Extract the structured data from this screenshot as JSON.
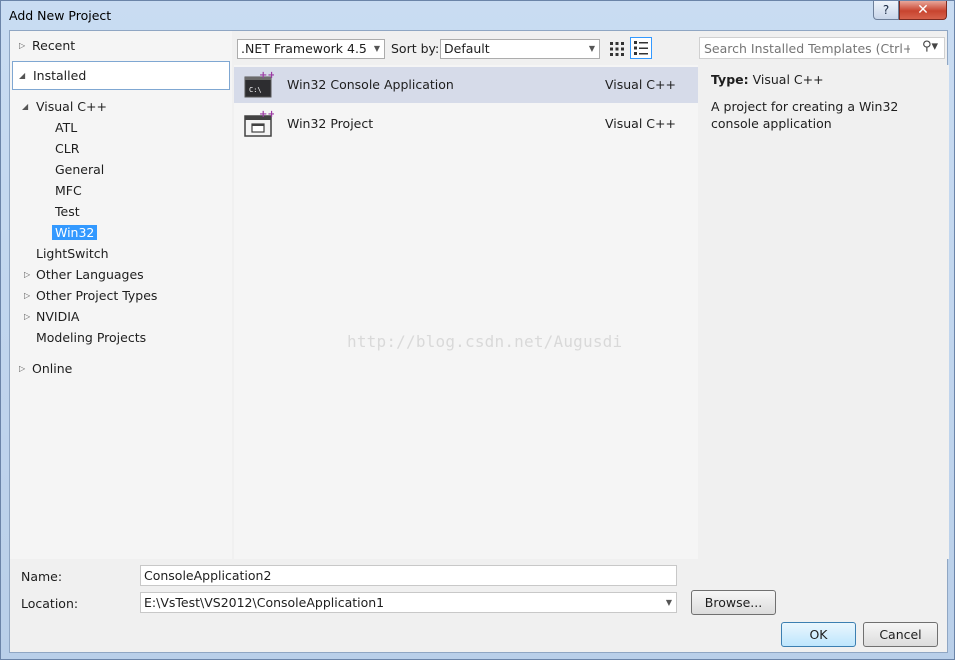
{
  "window": {
    "title": "Add New Project",
    "help_glyph": "?",
    "close_glyph": "✕"
  },
  "left_tree": {
    "recent": "Recent",
    "installed": "Installed",
    "visual_cpp": "Visual C++",
    "visual_cpp_children": [
      "ATL",
      "CLR",
      "General",
      "MFC",
      "Test",
      "Win32"
    ],
    "selected_child": "Win32",
    "lightswitch": "LightSwitch",
    "other_languages": "Other Languages",
    "other_project_types": "Other Project Types",
    "nvidia": "NVIDIA",
    "modeling_projects": "Modeling Projects",
    "online": "Online"
  },
  "toolbar": {
    "framework_value": ".NET Framework 4.5",
    "sort_label": "Sort by:",
    "sort_value": "Default"
  },
  "templates": [
    {
      "name": "Win32 Console Application",
      "language": "Visual C++",
      "selected": true,
      "icon": "console-app-icon"
    },
    {
      "name": "Win32 Project",
      "language": "Visual C++",
      "selected": false,
      "icon": "win32-project-icon"
    }
  ],
  "watermark": "http://blog.csdn.net/Augusdi",
  "search": {
    "placeholder": "Search Installed Templates (Ctrl+E)"
  },
  "details": {
    "type_label": "Type:",
    "type_value": "Visual C++",
    "description": "A project for creating a Win32 console application"
  },
  "form": {
    "name_label": "Name:",
    "name_value": "ConsoleApplication2",
    "location_label": "Location:",
    "location_value": "E:\\VsTest\\VS2012\\ConsoleApplication1",
    "browse_label": "Browse...",
    "ok_label": "OK",
    "cancel_label": "Cancel"
  },
  "colors": {
    "selection": "#3399ff",
    "selected_row": "#d6dbe9",
    "accent_border": "#3c7fb1"
  }
}
